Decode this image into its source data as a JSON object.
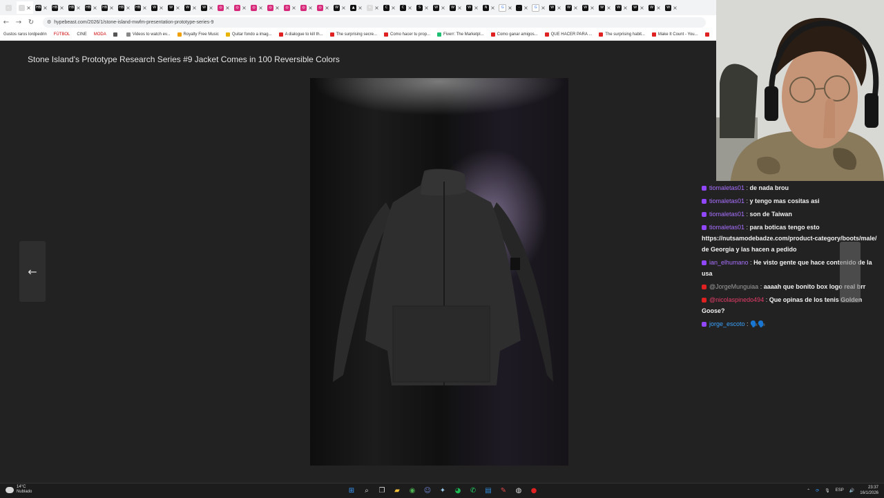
{
  "browser": {
    "tabs": [
      {
        "icon": "window-menu",
        "glyph": "⌄"
      },
      {
        "icon": "generic-tab",
        "glyph": "◦",
        "active": true
      },
      {
        "icon": "hypebeast-favicon",
        "glyph": "HB"
      },
      {
        "icon": "hypebeast-favicon",
        "glyph": "HB"
      },
      {
        "icon": "hypebeast-favicon",
        "glyph": "HB"
      },
      {
        "icon": "hypebeast-favicon",
        "glyph": "HB"
      },
      {
        "icon": "hypebeast-favicon",
        "glyph": "HB"
      },
      {
        "icon": "hypebeast-favicon",
        "glyph": "HB"
      },
      {
        "icon": "hypebeast-favicon",
        "glyph": "HB"
      },
      {
        "icon": "generic-favicon",
        "glyph": "W"
      },
      {
        "icon": "generic-favicon",
        "glyph": "W"
      },
      {
        "icon": "generic-favicon",
        "glyph": "W"
      },
      {
        "icon": "generic-favicon",
        "glyph": "W"
      },
      {
        "icon": "instagram-favicon",
        "glyph": "◎"
      },
      {
        "icon": "instagram-favicon",
        "glyph": "◎"
      },
      {
        "icon": "instagram-favicon",
        "glyph": "◎"
      },
      {
        "icon": "instagram-favicon",
        "glyph": "◎"
      },
      {
        "icon": "instagram-favicon",
        "glyph": "◎"
      },
      {
        "icon": "instagram-favicon",
        "glyph": "◎"
      },
      {
        "icon": "instagram-favicon",
        "glyph": "◎"
      },
      {
        "icon": "generic-favicon",
        "glyph": "W"
      },
      {
        "icon": "arc-favicon",
        "glyph": "▲"
      },
      {
        "icon": "new-tab-plus",
        "glyph": "+"
      },
      {
        "icon": "generic-favicon",
        "glyph": "C"
      },
      {
        "icon": "generic-favicon",
        "glyph": "C"
      },
      {
        "icon": "generic-favicon",
        "glyph": "S"
      },
      {
        "icon": "generic-favicon",
        "glyph": "W"
      },
      {
        "icon": "generic-favicon",
        "glyph": "W"
      },
      {
        "icon": "generic-favicon",
        "glyph": "W"
      },
      {
        "icon": "netflix-favicon",
        "glyph": "N"
      },
      {
        "icon": "google-favicon",
        "glyph": "G"
      },
      {
        "icon": "generic-favicon",
        "glyph": "·"
      },
      {
        "icon": "google-favicon",
        "glyph": "G"
      },
      {
        "icon": "generic-favicon",
        "glyph": "W"
      },
      {
        "icon": "generic-favicon",
        "glyph": "W"
      },
      {
        "icon": "generic-favicon",
        "glyph": "W"
      },
      {
        "icon": "generic-favicon",
        "glyph": "W"
      },
      {
        "icon": "generic-favicon",
        "glyph": "W"
      },
      {
        "icon": "generic-favicon",
        "glyph": "W"
      },
      {
        "icon": "generic-favicon",
        "glyph": "W"
      },
      {
        "icon": "generic-favicon",
        "glyph": "W"
      }
    ],
    "url": "hypebeast.com/2026/1/stone-island-mwfm-presentation-prototype-series-9",
    "bookmarks": [
      {
        "label": "Gustos raros lordpedrin",
        "icon_color": ""
      },
      {
        "label": "FÚTBOL",
        "icon_color": "",
        "red": true
      },
      {
        "label": "CINE",
        "icon_color": ""
      },
      {
        "label": "MODA",
        "icon_color": "",
        "red": true
      },
      {
        "label": "",
        "icon_color": "#555"
      },
      {
        "label": "Videos to watch ev...",
        "icon_color": "#888"
      },
      {
        "label": "Royalty Free Music",
        "icon_color": "#f0a000"
      },
      {
        "label": "Quitar fondo a imag...",
        "icon_color": "#e8b400"
      },
      {
        "label": "A dialogue to kill th...",
        "icon_color": "#e02121"
      },
      {
        "label": "The surprising secre...",
        "icon_color": "#e02121"
      },
      {
        "label": "Como hacer tu prop...",
        "icon_color": "#e02121"
      },
      {
        "label": "Fiverr: The Marketpl...",
        "icon_color": "#1dbf73"
      },
      {
        "label": "Como ganar amigos...",
        "icon_color": "#e02121"
      },
      {
        "label": "QUE HACER PARA ...",
        "icon_color": "#e02121"
      },
      {
        "label": "The surprising habit...",
        "icon_color": "#e02121"
      },
      {
        "label": "Make It Count - You...",
        "icon_color": "#e02121"
      },
      {
        "label": "",
        "icon_color": "#e02121"
      }
    ]
  },
  "page": {
    "title": "Stone Island's Prototype Research Series #9 Jacket Comes in 100 Reversible Colors",
    "prev_arrow": "←"
  },
  "chat": {
    "messages": [
      {
        "platform": "twitch",
        "user": "tiomaletas01",
        "text": "de nada brou"
      },
      {
        "platform": "twitch",
        "user": "tiomaletas01",
        "text": "y tengo mas cositas asi"
      },
      {
        "platform": "twitch",
        "user": "tiomaletas01",
        "text": "son de Taiwan"
      },
      {
        "platform": "twitch",
        "user": "tiomaletas01",
        "text": "para boticas tengo esto https://nutsamodebadze.com/product-category/boots/male/ de Georgia y las hacen a pedido"
      },
      {
        "platform": "twitch",
        "user": "ian_elhumano",
        "text": "He visto gente que hace contenido de la usa",
        "color": "purple"
      },
      {
        "platform": "youtube",
        "user": "@JorgeMunguiaa",
        "text": "aaaah que bonito box logo real brr"
      },
      {
        "platform": "youtube",
        "user": "@nicolaspinedo494",
        "text": "Que opinas de los tenis Golden Goose?",
        "color": "pink"
      },
      {
        "platform": "twitch",
        "user": "jorge_escoto",
        "text": "🗣️🗣️",
        "color": "blue"
      }
    ]
  },
  "taskbar": {
    "weather_temp": "14°C",
    "weather_desc": "Nublado",
    "apps": [
      {
        "icon": "windows-start-icon",
        "glyph": "⊞",
        "color": "#3a9bff"
      },
      {
        "icon": "search-icon",
        "glyph": "⌕",
        "color": "#ddd"
      },
      {
        "icon": "task-view-icon",
        "glyph": "❐",
        "color": "#ddd"
      },
      {
        "icon": "file-explorer-icon",
        "glyph": "▰",
        "color": "#f3c13a"
      },
      {
        "icon": "chrome-icon",
        "glyph": "◉",
        "color": "#4caf50"
      },
      {
        "icon": "discord-icon",
        "glyph": "☺",
        "color": "#7289da"
      },
      {
        "icon": "steam-icon",
        "glyph": "✦",
        "color": "#9ac8e8"
      },
      {
        "icon": "spotify-icon",
        "glyph": "◕",
        "color": "#1db954"
      },
      {
        "icon": "whatsapp-icon",
        "glyph": "✆",
        "color": "#25d366"
      },
      {
        "icon": "app-icon",
        "glyph": "▤",
        "color": "#2f8fe0"
      },
      {
        "icon": "app-icon",
        "glyph": "✎",
        "color": "#e04848"
      },
      {
        "icon": "obs-icon",
        "glyph": "◍",
        "color": "#ddd"
      },
      {
        "icon": "record-icon",
        "glyph": "●",
        "color": "#e02121"
      }
    ],
    "tray": {
      "lang": "ESP",
      "time": "23:37",
      "date": "16/1/2026"
    }
  }
}
